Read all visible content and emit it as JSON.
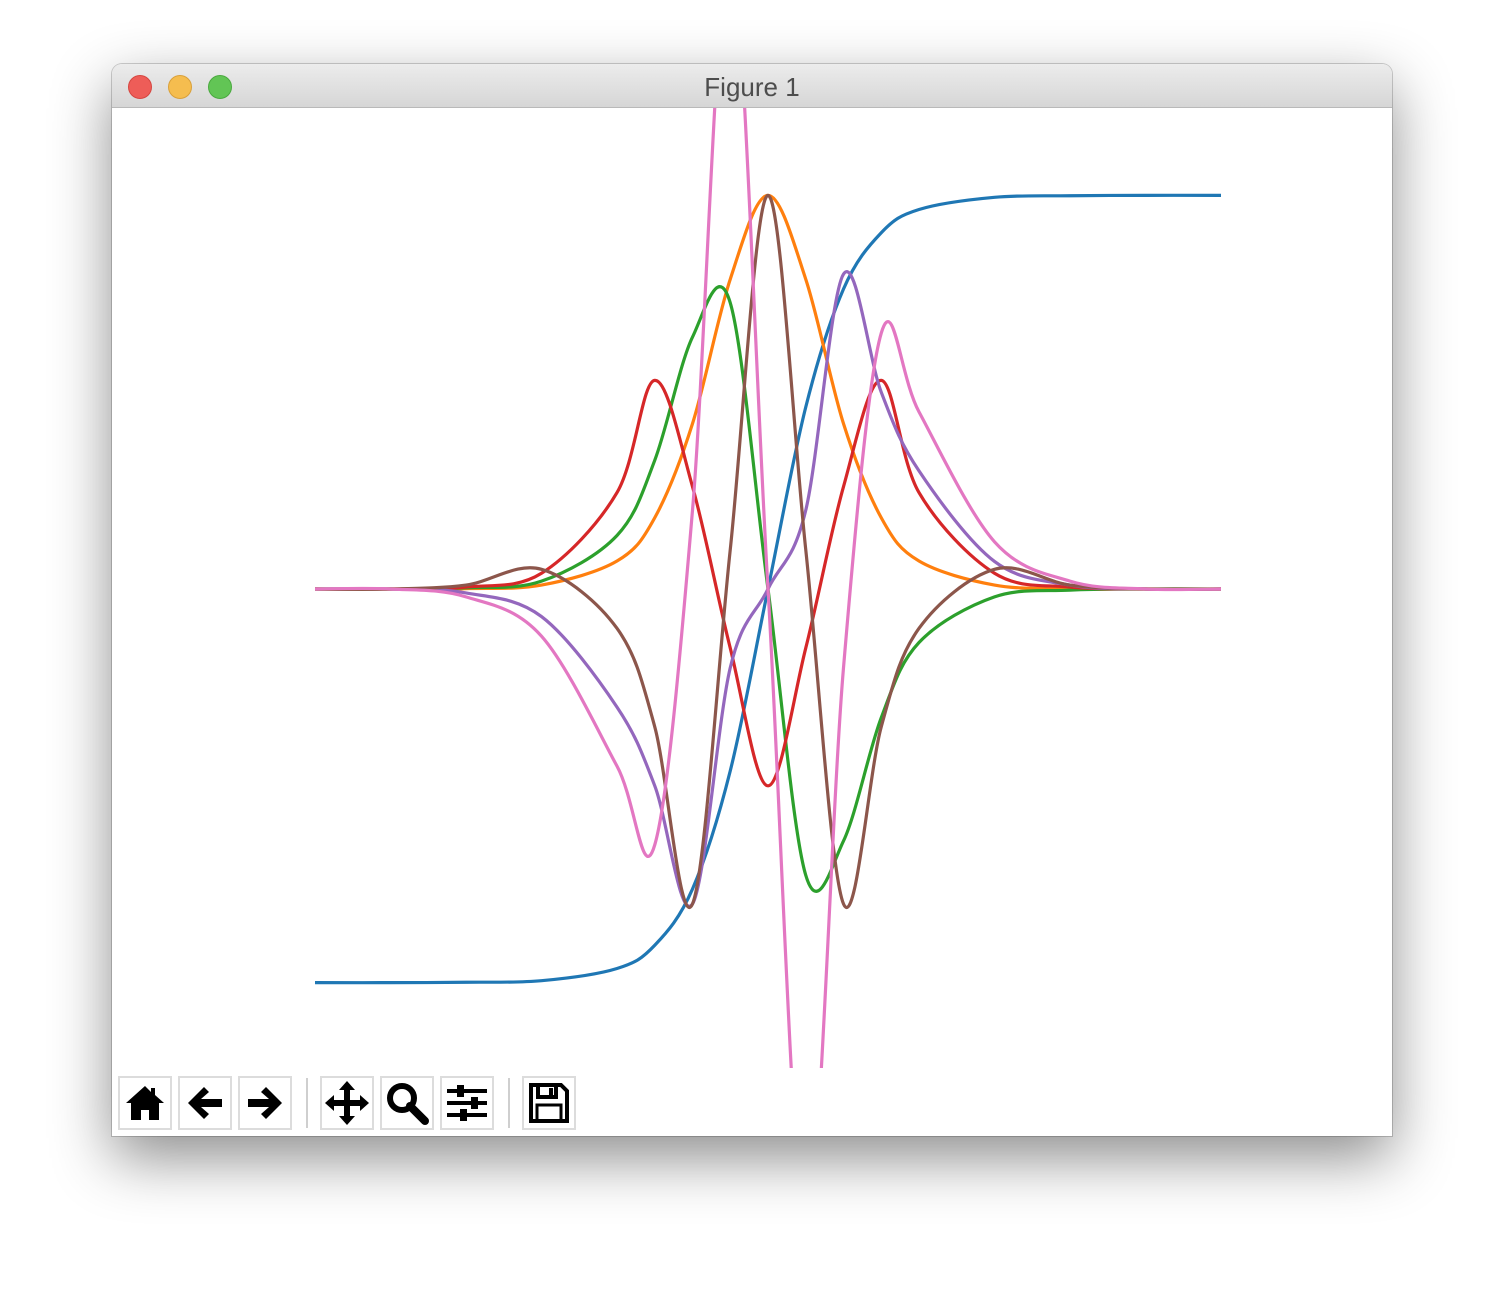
{
  "window": {
    "title": "Figure 1"
  },
  "toolbar": {
    "buttons": [
      {
        "icon": "home-icon",
        "action": "home"
      },
      {
        "icon": "back-arrow-icon",
        "action": "back"
      },
      {
        "icon": "forward-arrow-icon",
        "action": "forward"
      },
      {
        "icon": "pan-icon",
        "action": "pan"
      },
      {
        "icon": "zoom-icon",
        "action": "zoom"
      },
      {
        "icon": "subplots-icon",
        "action": "configure-subplots"
      },
      {
        "icon": "save-icon",
        "action": "save"
      }
    ]
  },
  "chart_data": {
    "type": "line",
    "title": "",
    "xlabel": "",
    "ylabel": "",
    "axes_visible": false,
    "xlim": [
      -6,
      6
    ],
    "ylim": [
      -1.1,
      1.1
    ],
    "grid": false,
    "series": [
      {
        "color": "#1f77b4",
        "x": [
          -6,
          -5,
          -4,
          -3,
          -2,
          -1.5,
          -1,
          -0.5,
          0,
          0.5,
          1,
          1.5,
          2,
          3,
          4,
          5,
          6
        ],
        "values": [
          -1.0,
          -1.0,
          -0.999,
          -0.995,
          -0.964,
          -0.905,
          -0.762,
          -0.462,
          0.0,
          0.462,
          0.762,
          0.905,
          0.964,
          0.995,
          0.999,
          1.0,
          1.0
        ]
      },
      {
        "color": "#ff7f0e",
        "x": [
          -6,
          -5,
          -4,
          -3,
          -2,
          -1.5,
          -1,
          -0.5,
          0,
          0.5,
          1,
          1.5,
          2,
          3,
          4,
          5,
          6
        ],
        "values": [
          0.0,
          0.0,
          0.001,
          0.01,
          0.071,
          0.181,
          0.42,
          0.787,
          1.0,
          0.787,
          0.42,
          0.181,
          0.071,
          0.01,
          0.001,
          0.0,
          0.0
        ]
      },
      {
        "color": "#2ca02c",
        "x": [
          -6,
          -5,
          -4,
          -3,
          -2,
          -1.5,
          -1,
          -0.5,
          0,
          0.5,
          1,
          1.5,
          2,
          3,
          4,
          5,
          6
        ],
        "values": [
          0.0,
          0.0,
          0.003,
          0.02,
          0.136,
          0.327,
          0.64,
          0.727,
          0.0,
          -0.727,
          -0.64,
          -0.327,
          -0.136,
          -0.02,
          -0.003,
          0.0,
          0.0
        ]
      },
      {
        "color": "#d62728",
        "x": [
          -6,
          -5,
          -4,
          -3,
          -2,
          -1.5,
          -1,
          -0.5,
          0,
          0.5,
          1,
          1.5,
          2,
          3,
          4,
          5,
          6
        ],
        "values": [
          0.0,
          0.0,
          0.005,
          0.04,
          0.245,
          0.53,
          0.26,
          -0.15,
          -0.5,
          -0.15,
          0.26,
          0.53,
          0.245,
          0.04,
          0.005,
          0.0,
          0.0
        ]
      },
      {
        "color": "#9467bd",
        "x": [
          -6,
          -5,
          -4,
          -3,
          -2,
          -1.5,
          -1,
          -0.5,
          0,
          0.5,
          1,
          1.5,
          2,
          3,
          4,
          5,
          6
        ],
        "values": [
          0.0,
          0.0,
          -0.01,
          -0.07,
          -0.3,
          -0.5,
          -0.8,
          -0.2,
          0.0,
          0.2,
          0.8,
          0.5,
          0.3,
          0.07,
          0.01,
          0.0,
          0.0
        ]
      },
      {
        "color": "#8c564b",
        "x": [
          -6,
          -5,
          -4,
          -3,
          -2,
          -1.5,
          -1,
          -0.5,
          0,
          0.5,
          1,
          1.5,
          2,
          3,
          4,
          5,
          6
        ],
        "values": [
          0.0,
          0.0,
          0.01,
          0.05,
          -0.1,
          -0.35,
          -0.8,
          0.1,
          1.0,
          0.1,
          -0.8,
          -0.35,
          -0.1,
          0.05,
          0.01,
          0.0,
          0.0
        ]
      },
      {
        "color": "#e377c2",
        "x": [
          -6,
          -5,
          -4,
          -3,
          -2,
          -1.5,
          -1,
          -0.5,
          0,
          0.5,
          1,
          1.5,
          2,
          3,
          4,
          5,
          6
        ],
        "values": [
          0.0,
          0.0,
          -0.02,
          -0.12,
          -0.45,
          -0.65,
          0.2,
          1.62,
          0.0,
          -1.62,
          -0.2,
          0.65,
          0.45,
          0.12,
          0.02,
          0.0,
          0.0
        ]
      }
    ]
  }
}
